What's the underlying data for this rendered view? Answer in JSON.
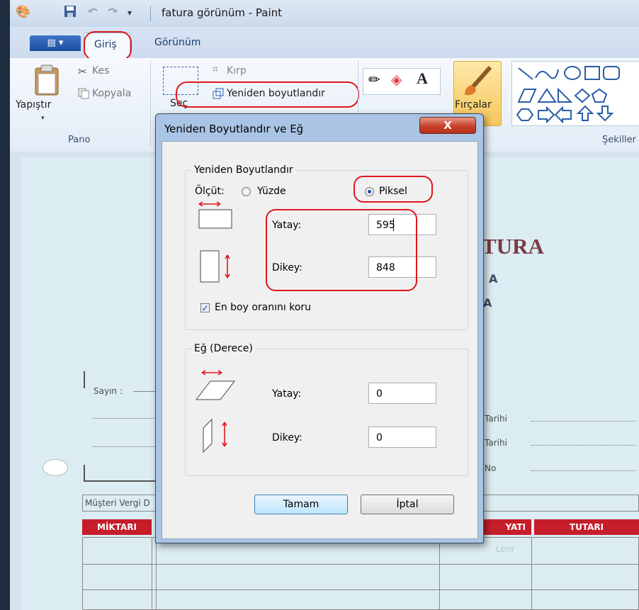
{
  "window": {
    "title": "fatura görünüm - Paint"
  },
  "ribbon": {
    "tabs": [
      "Giriş",
      "Görünüm"
    ],
    "clipboard": {
      "paste": "Yapıştır",
      "cut": "Kes",
      "copy": "Kopyala",
      "group": "Pano"
    },
    "image": {
      "crop": "Kırp",
      "resize": "Yeniden boyutlandır",
      "select": "Seç"
    },
    "brushes": "Fırçalar",
    "shapes_group": "Şekiller"
  },
  "document": {
    "title": "TURA",
    "letters": [
      "A",
      "A"
    ],
    "dear": "Sayın :",
    "fields": [
      "Tarihi",
      "Tarihi",
      "No"
    ],
    "tax": "Müşteri Vergi D",
    "columns": [
      "MİKTARI",
      "YATI",
      "TUTARI"
    ],
    "faint": "Lenr"
  },
  "dialog": {
    "title": "Yeniden Boyutlandır ve Eğ",
    "close": "X",
    "resize_section": "Yeniden Boyutlandır",
    "by_label": "Ölçüt:",
    "percent": "Yüzde",
    "pixels": "Piksel",
    "horizontal": "Yatay:",
    "vertical": "Dikey:",
    "resize_h": "595",
    "resize_v": "848",
    "keep_ratio": "En boy oranını koru",
    "skew_section": "Eğ (Derece)",
    "skew_h": "0",
    "skew_v": "0",
    "ok": "Tamam",
    "cancel": "İptal"
  },
  "colors": {
    "annotation": "#e0171d",
    "accent": "#c61d2b"
  }
}
